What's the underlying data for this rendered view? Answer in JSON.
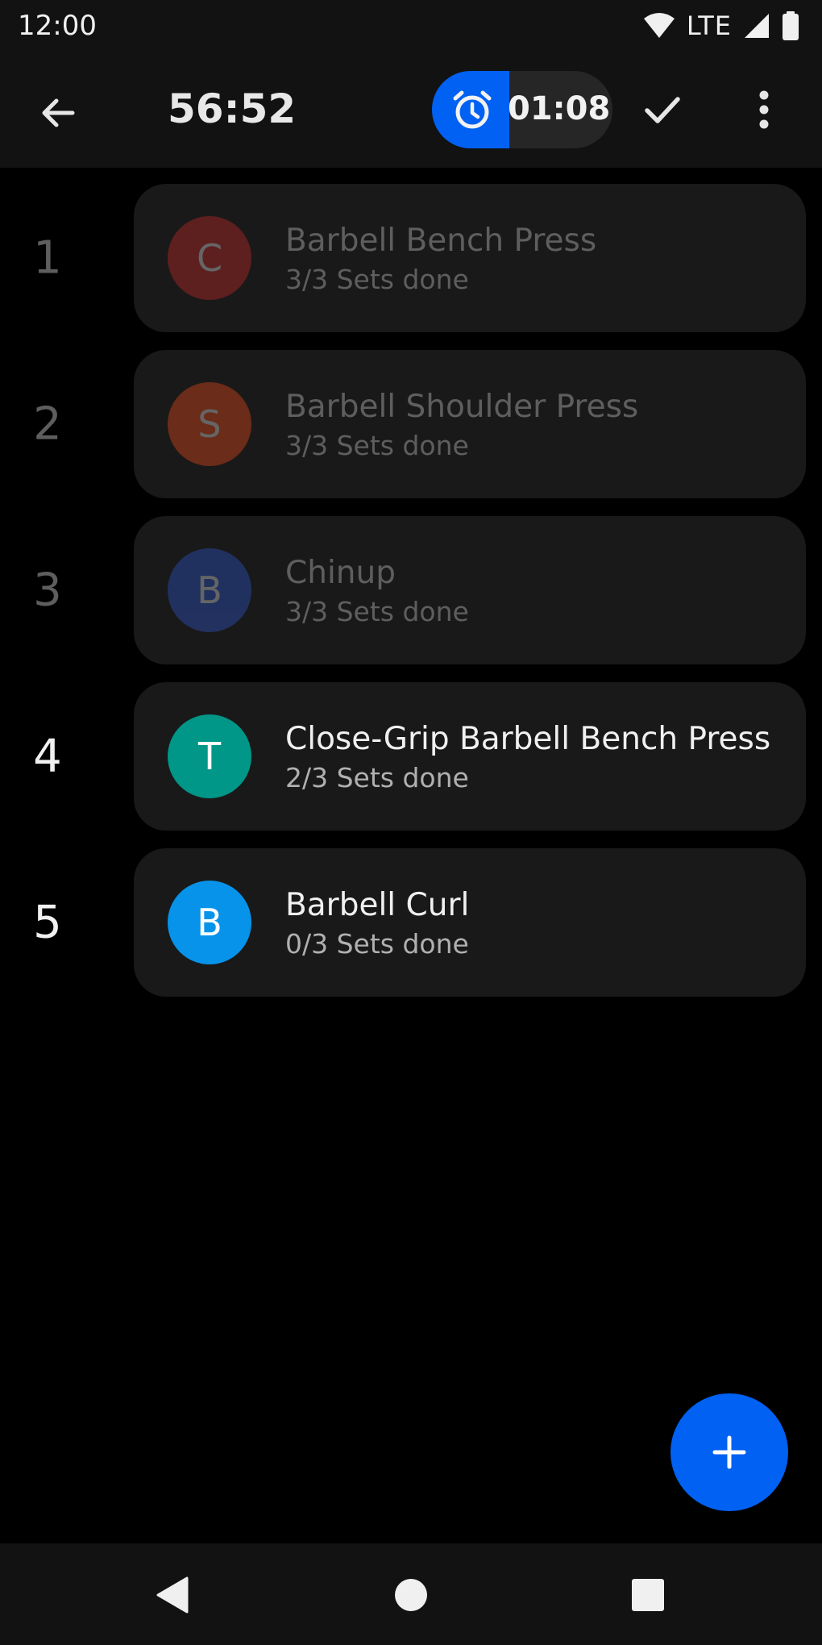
{
  "status_bar": {
    "time": "12:00",
    "network": "LTE",
    "icons": [
      "wifi-icon",
      "signal-icon",
      "battery-icon"
    ]
  },
  "app_bar": {
    "elapsed_time": "56:52",
    "rest_timer": {
      "remaining": "01:08",
      "progress_fraction": 0.43,
      "icon": "alarm-clock-icon"
    },
    "icons": [
      "back-arrow-icon",
      "check-icon",
      "more-vert-icon"
    ]
  },
  "colors": {
    "accent": "#0061f2",
    "background": "#000000",
    "card": "#191919"
  },
  "exercises": [
    {
      "index": "1",
      "initial": "C",
      "name": "Barbell Bench Press",
      "sets": "3/3 Sets done",
      "color": "#c62828",
      "done": true
    },
    {
      "index": "2",
      "initial": "S",
      "name": "Barbell Shoulder Press",
      "sets": "3/3 Sets done",
      "color": "#e64a19",
      "done": true
    },
    {
      "index": "3",
      "initial": "B",
      "name": "Chinup",
      "sets": "3/3 Sets done",
      "color": "#2f55c9",
      "done": true
    },
    {
      "index": "4",
      "initial": "T",
      "name": "Close-Grip Barbell Bench Press",
      "sets": "2/3 Sets done",
      "color": "#009688",
      "done": false
    },
    {
      "index": "5",
      "initial": "B",
      "name": "Barbell Curl",
      "sets": "0/3 Sets done",
      "color": "#0793ea",
      "done": false
    }
  ],
  "fab": {
    "icon": "plus-icon"
  },
  "nav_bar": {
    "icons": [
      "nav-back-icon",
      "nav-home-icon",
      "nav-recents-icon"
    ]
  }
}
